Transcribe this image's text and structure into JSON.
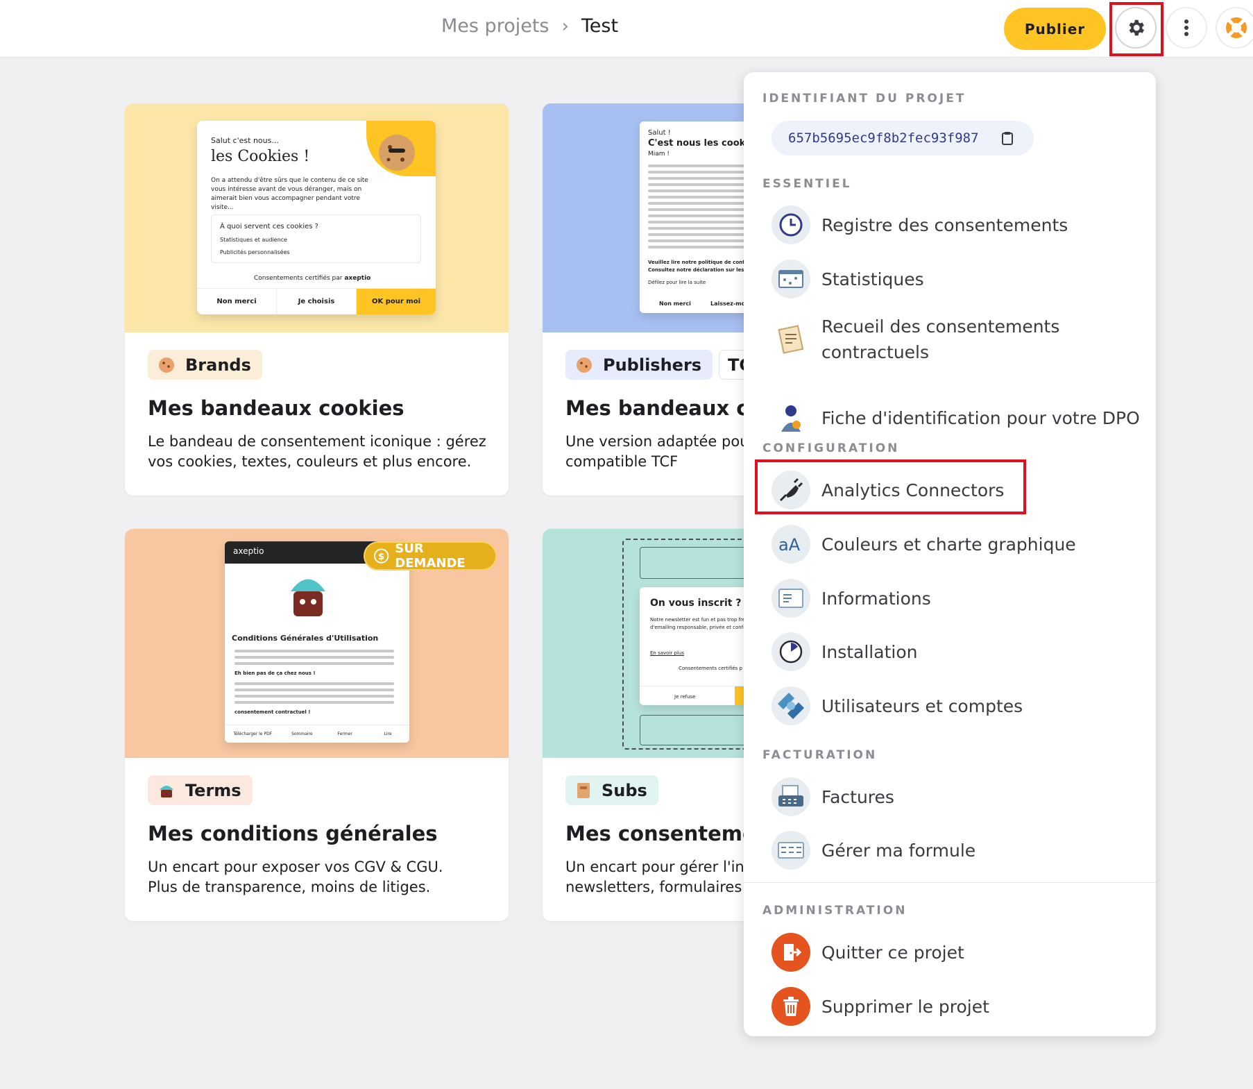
{
  "breadcrumb": {
    "parent": "Mes projets",
    "separator": "›",
    "current": "Test"
  },
  "topbar": {
    "publish_label": "Publier"
  },
  "cards": [
    {
      "tag": "Brands",
      "tag_bg": "#fbeed8",
      "title": "Mes bandeaux cookies",
      "desc": "Le bandeau de consentement iconique : gérez vos cookies, textes, couleurs et plus encore.",
      "media_bg": "#fbe6a8",
      "mock": {
        "greeting": "Salut c'est nous...",
        "headline": "les Cookies !",
        "intro": "On a attendu d'être sûrs que le contenu de ce site vous intéresse avant de vous déranger, mais on aimerait bien vous accompagner pendant votre visite...",
        "question": "À quoi servent ces cookies ?",
        "item1": "Statistiques et audience",
        "item2": "Publicités personnalisées",
        "certified": "Consentements certifiés par",
        "brand": "axeptio",
        "btn_no": "Non merci",
        "btn_choose": "Je choisis",
        "btn_ok": "OK pour moi"
      }
    },
    {
      "tag": "Publishers",
      "tag2": "TC",
      "tag_bg": "#e6ecfb",
      "title": "Mes bandeaux cookies",
      "desc": "Une version adaptée pour la publicité, compatible TCF",
      "media_bg": "#a8bff2",
      "mock": {
        "greeting": "Salut !",
        "headline": "C'est nous les cookies",
        "sub": "Miam !",
        "legal1": "Veuillez lire notre politique de confidentialité",
        "legal2": "Consultez notre déclaration sur les cookies",
        "scroll": "Défilez pour lire la suite",
        "btn_no": "Non merci",
        "btn_let": "Laissez-moi c"
      }
    },
    {
      "tag": "Terms",
      "tag_bg": "#fbe9e0",
      "title": "Mes conditions générales",
      "desc": "Un encart pour exposer vos CGV & CGU. Plus de transparence, moins de litiges.",
      "media_bg": "#f8c6a0",
      "badge": "SUR DEMANDE",
      "mock": {
        "brand": "axeptio",
        "title": "Conditions Générales d'Utilisation",
        "highlight": "Eh bien pas de ça chez nous !",
        "strong": "consentement contractuel !",
        "btn_pdf": "Télécharger le PDF",
        "btn_summary": "Sommaire",
        "btn_close": "Fermer",
        "btn_read": "Lire"
      }
    },
    {
      "tag": "Subs",
      "tag_bg": "#e2f4f2",
      "title": "Mes consentements",
      "desc": "Un encart pour gérer l'inscription à vos newsletters, formulaires",
      "media_bg": "#b6e2dc",
      "mock": {
        "question": "On vous inscrit ?",
        "body": "Notre newsletter est fun et pas trop fréquente, passe par une solution d'emailing responsable, privée et conforme au RGPD.",
        "more": "En savoir plus",
        "certified": "Consentements certifiés p",
        "btn_refuse": "Je refuse"
      }
    }
  ],
  "menu": {
    "project_id_label": "IDENTIFIANT DU PROJET",
    "project_id": "657b5695ec9f8b2fec93f987",
    "sections": {
      "essentiel": "ESSENTIEL",
      "configuration": "CONFIGURATION",
      "facturation": "FACTURATION",
      "administration": "ADMINISTRATION"
    },
    "items": {
      "registre": "Registre des consentements",
      "stats": "Statistiques",
      "recueil": "Recueil des consentements contractuels",
      "dpo": "Fiche d'identification pour votre DPO",
      "analytics": "Analytics Connectors",
      "couleurs": "Couleurs et charte graphique",
      "informations": "Informations",
      "installation": "Installation",
      "utilisateurs": "Utilisateurs et comptes",
      "factures": "Factures",
      "formule": "Gérer ma formule",
      "quitter": "Quitter ce projet",
      "supprimer": "Supprimer le projet"
    }
  },
  "colors": {
    "accent": "#fdc423",
    "highlight": "#e0101c",
    "danger": "#e5531f"
  }
}
